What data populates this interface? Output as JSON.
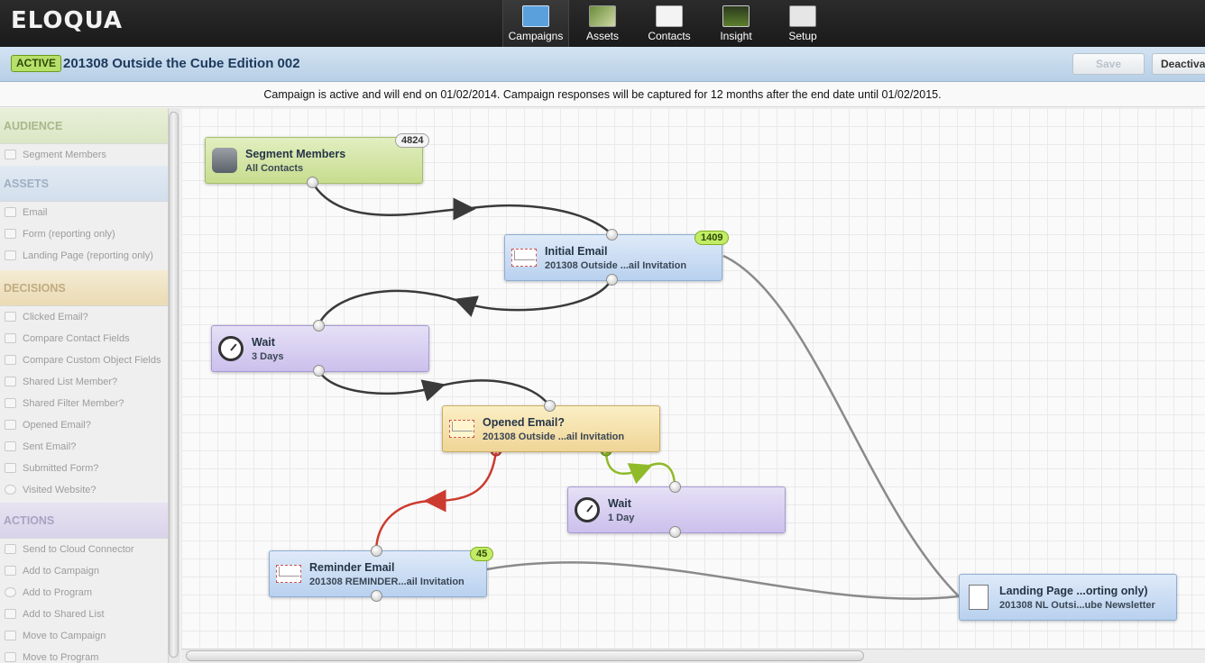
{
  "app": {
    "logo": "ELOQUA"
  },
  "nav": [
    {
      "label": "Campaigns",
      "icon": "campaigns-icon",
      "active": true
    },
    {
      "label": "Assets",
      "icon": "assets-icon"
    },
    {
      "label": "Contacts",
      "icon": "contacts-icon"
    },
    {
      "label": "Insight",
      "icon": "insight-icon"
    },
    {
      "label": "Setup",
      "icon": "setup-icon"
    }
  ],
  "campaign": {
    "status": "ACTIVE",
    "title": "201308 Outside the Cube Edition 002",
    "save_label": "Save",
    "deactivate_label": "Deactiva",
    "notice": "Campaign is active and will end on 01/02/2014. Campaign responses will be captured for 12 months after the end date until 01/02/2015."
  },
  "sidebar": {
    "audience": {
      "title": "AUDIENCE",
      "items": [
        "Segment Members"
      ]
    },
    "assets": {
      "title": "ASSETS",
      "items": [
        "Email",
        "Form (reporting only)",
        "Landing Page (reporting only)"
      ]
    },
    "decisions": {
      "title": "DECISIONS",
      "items": [
        "Clicked Email?",
        "Compare Contact Fields",
        "Compare Custom Object Fields",
        "Shared List Member?",
        "Shared Filter Member?",
        "Opened Email?",
        "Sent Email?",
        "Submitted Form?",
        "Visited Website?"
      ]
    },
    "actions": {
      "title": "ACTIONS",
      "items": [
        "Send to Cloud Connector",
        "Add to Campaign",
        "Add to Program",
        "Add to Shared List",
        "Move to Campaign",
        "Move to Program"
      ]
    }
  },
  "canvas": {
    "segment": {
      "title": "Segment Members",
      "subtitle": "All Contacts",
      "count": "4824"
    },
    "initial_email": {
      "title": "Initial Email",
      "subtitle": "201308 Outside ...ail Invitation",
      "count": "1409"
    },
    "wait1": {
      "title": "Wait",
      "subtitle": "3 Days"
    },
    "opened": {
      "title": "Opened Email?",
      "subtitle": "201308 Outside ...ail Invitation"
    },
    "wait2": {
      "title": "Wait",
      "subtitle": "1 Day"
    },
    "reminder": {
      "title": "Reminder Email",
      "subtitle": "201308 REMINDER...ail Invitation",
      "count": "45"
    },
    "landing": {
      "title": "Landing Page ...orting only)",
      "subtitle": "201308 NL Outsi...ube Newsletter"
    }
  },
  "colors": {
    "yes_branch": "#8fba2a",
    "no_branch": "#cc3b2f",
    "flow": "#3a3a3a",
    "passive_flow": "#8a8a8a"
  }
}
